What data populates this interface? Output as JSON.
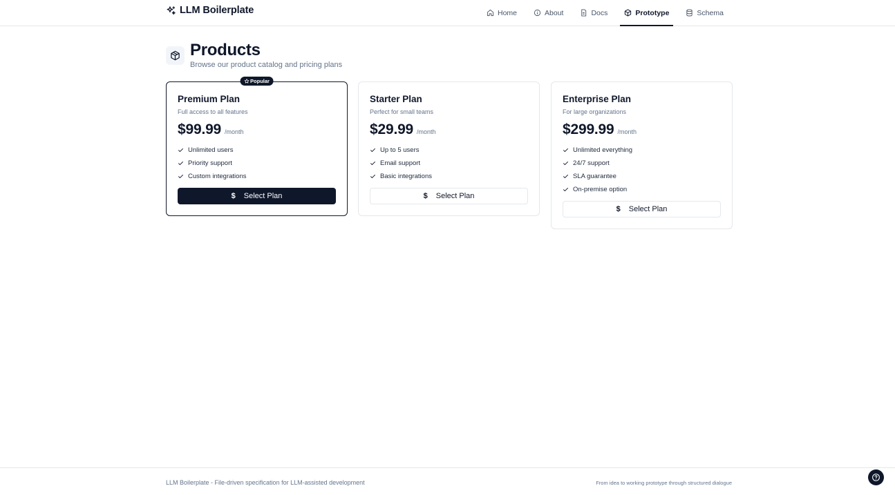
{
  "header": {
    "brand_name": "LLM Boilerplate",
    "brand_icon": "sparkles-icon",
    "nav": [
      {
        "label": "Home",
        "icon": "home-icon",
        "active": false
      },
      {
        "label": "About",
        "icon": "info-icon",
        "active": false
      },
      {
        "label": "Docs",
        "icon": "document-icon",
        "active": false
      },
      {
        "label": "Prototype",
        "icon": "box-icon",
        "active": true
      },
      {
        "label": "Schema",
        "icon": "database-icon",
        "active": false
      }
    ]
  },
  "page": {
    "title": "Products",
    "subtitle": "Browse our product catalog and pricing plans",
    "icon": "box-icon"
  },
  "plans": [
    {
      "name": "Premium Plan",
      "description": "Full access to all features",
      "price": "$99.99",
      "period": "/month",
      "badge": "Popular",
      "features": [
        "Unlimited users",
        "Priority support",
        "Custom integrations"
      ],
      "button_label": "Select Plan",
      "button_icon": "$",
      "highlighted": true
    },
    {
      "name": "Starter Plan",
      "description": "Perfect for small teams",
      "price": "$29.99",
      "period": "/month",
      "features": [
        "Up to 5 users",
        "Email support",
        "Basic integrations"
      ],
      "button_label": "Select Plan",
      "button_icon": "$",
      "highlighted": false
    },
    {
      "name": "Enterprise Plan",
      "description": "For large organizations",
      "price": "$299.99",
      "period": "/month",
      "features": [
        "Unlimited everything",
        "24/7 support",
        "SLA guarantee",
        "On-premise option"
      ],
      "button_label": "Select Plan",
      "button_icon": "$",
      "highlighted": false
    }
  ],
  "footer": {
    "left_text": "LLM Boilerplate - File-driven specification for LLM-assisted development",
    "right_text": "From idea to working prototype through structured dialogue"
  },
  "colors": {
    "primary": "#0f172a",
    "muted_text": "#64748b",
    "border": "#e5e7eb"
  }
}
